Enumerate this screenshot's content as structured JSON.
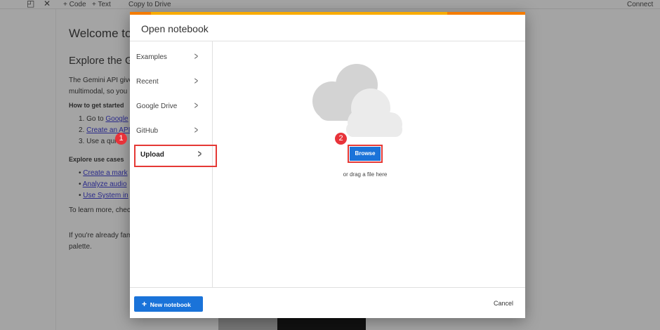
{
  "toolbar": {
    "code": "+ Code",
    "text": "+ Text",
    "copy": "Copy to Drive",
    "connect": "Connect"
  },
  "notebook": {
    "title": "Welcome to",
    "subtitle": "Explore the G",
    "para1_line1": "The Gemini API give",
    "para1_line2": "multimodal, so you",
    "how_heading": "How to get started",
    "steps": [
      "1. Go to ",
      "2. ",
      "3. Use a qui"
    ],
    "step_links": [
      "Google",
      "Create an API"
    ],
    "explore_heading": "Explore use cases",
    "use_cases": [
      "Create a mark",
      "Analyze audio",
      "Use System in"
    ],
    "learn_more": "To learn more, chec",
    "familiar_line1": "If you're already fam",
    "familiar_line2": "palette."
  },
  "annotations": {
    "one": "1",
    "two": "2"
  },
  "dialog": {
    "title": "Open notebook",
    "nav": [
      {
        "label": "Examples"
      },
      {
        "label": "Recent"
      },
      {
        "label": "Google Drive"
      },
      {
        "label": "GitHub"
      },
      {
        "label": "Upload",
        "selected": true
      }
    ],
    "browse_label": "Browse",
    "drag_hint": "or drag a file here",
    "new_notebook_label": "New notebook",
    "cancel_label": "Cancel"
  },
  "colors": {
    "accent": "#1a73d9",
    "highlight": "#e53935",
    "bar_orange": "#f57c00",
    "bar_yellow": "#f9ab00"
  }
}
